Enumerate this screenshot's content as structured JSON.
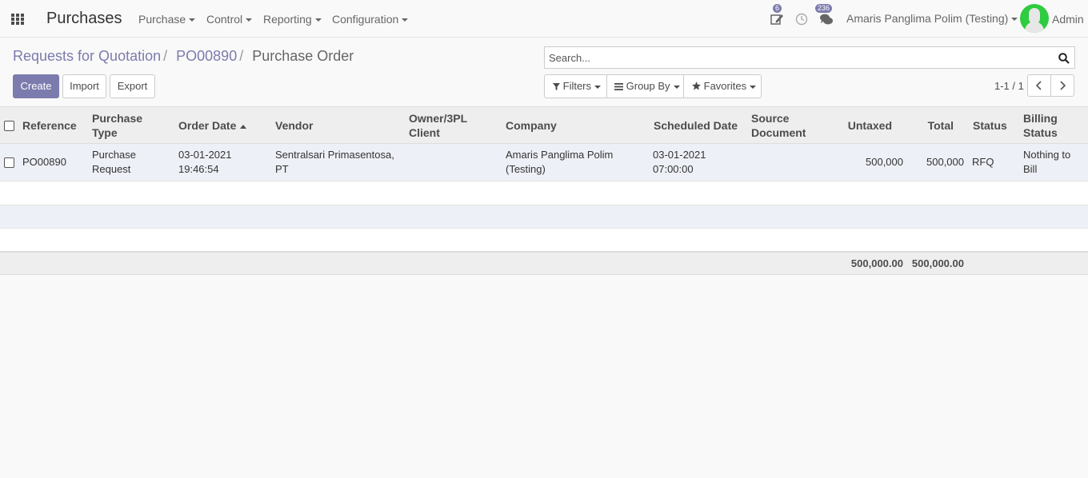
{
  "navbar": {
    "brand": "Purchases",
    "menus": [
      "Purchase",
      "Control",
      "Reporting",
      "Configuration"
    ],
    "activity_badge": "6",
    "messages_badge": "236",
    "company": "Amaris Panglima Polim (Testing)",
    "user": "Admin"
  },
  "breadcrumb": {
    "items": [
      "Requests for Quotation",
      "PO00890",
      "Purchase Order"
    ]
  },
  "search": {
    "placeholder": "Search..."
  },
  "buttons": {
    "create": "Create",
    "import": "Import",
    "export": "Export"
  },
  "search_options": {
    "filters": "Filters",
    "group_by": "Group By",
    "favorites": "Favorites"
  },
  "pager": {
    "value": "1-1 / 1"
  },
  "table": {
    "columns": [
      "Reference",
      "Purchase Type",
      "Order Date",
      "Vendor",
      "Owner/3PL Client",
      "Company",
      "Scheduled Date",
      "Source Document",
      "Untaxed",
      "Total",
      "Status",
      "Billing Status"
    ],
    "rows": [
      {
        "reference": "PO00890",
        "purchase_type": "Purchase Request",
        "order_date": "03-01-2021 19:46:54",
        "vendor": "Sentralsari Primasentosa, PT",
        "owner": "",
        "company": "Amaris Panglima Polim (Testing)",
        "scheduled_date": "03-01-2021 07:00:00",
        "source_document": "",
        "untaxed": "500,000",
        "total": "500,000",
        "status": "RFQ",
        "billing_status": "Nothing to Bill"
      }
    ],
    "totals": {
      "untaxed": "500,000.00",
      "total": "500,000.00"
    }
  },
  "colors": {
    "accent": "#7c7bad",
    "avatar_bg": "#2ecc40"
  }
}
